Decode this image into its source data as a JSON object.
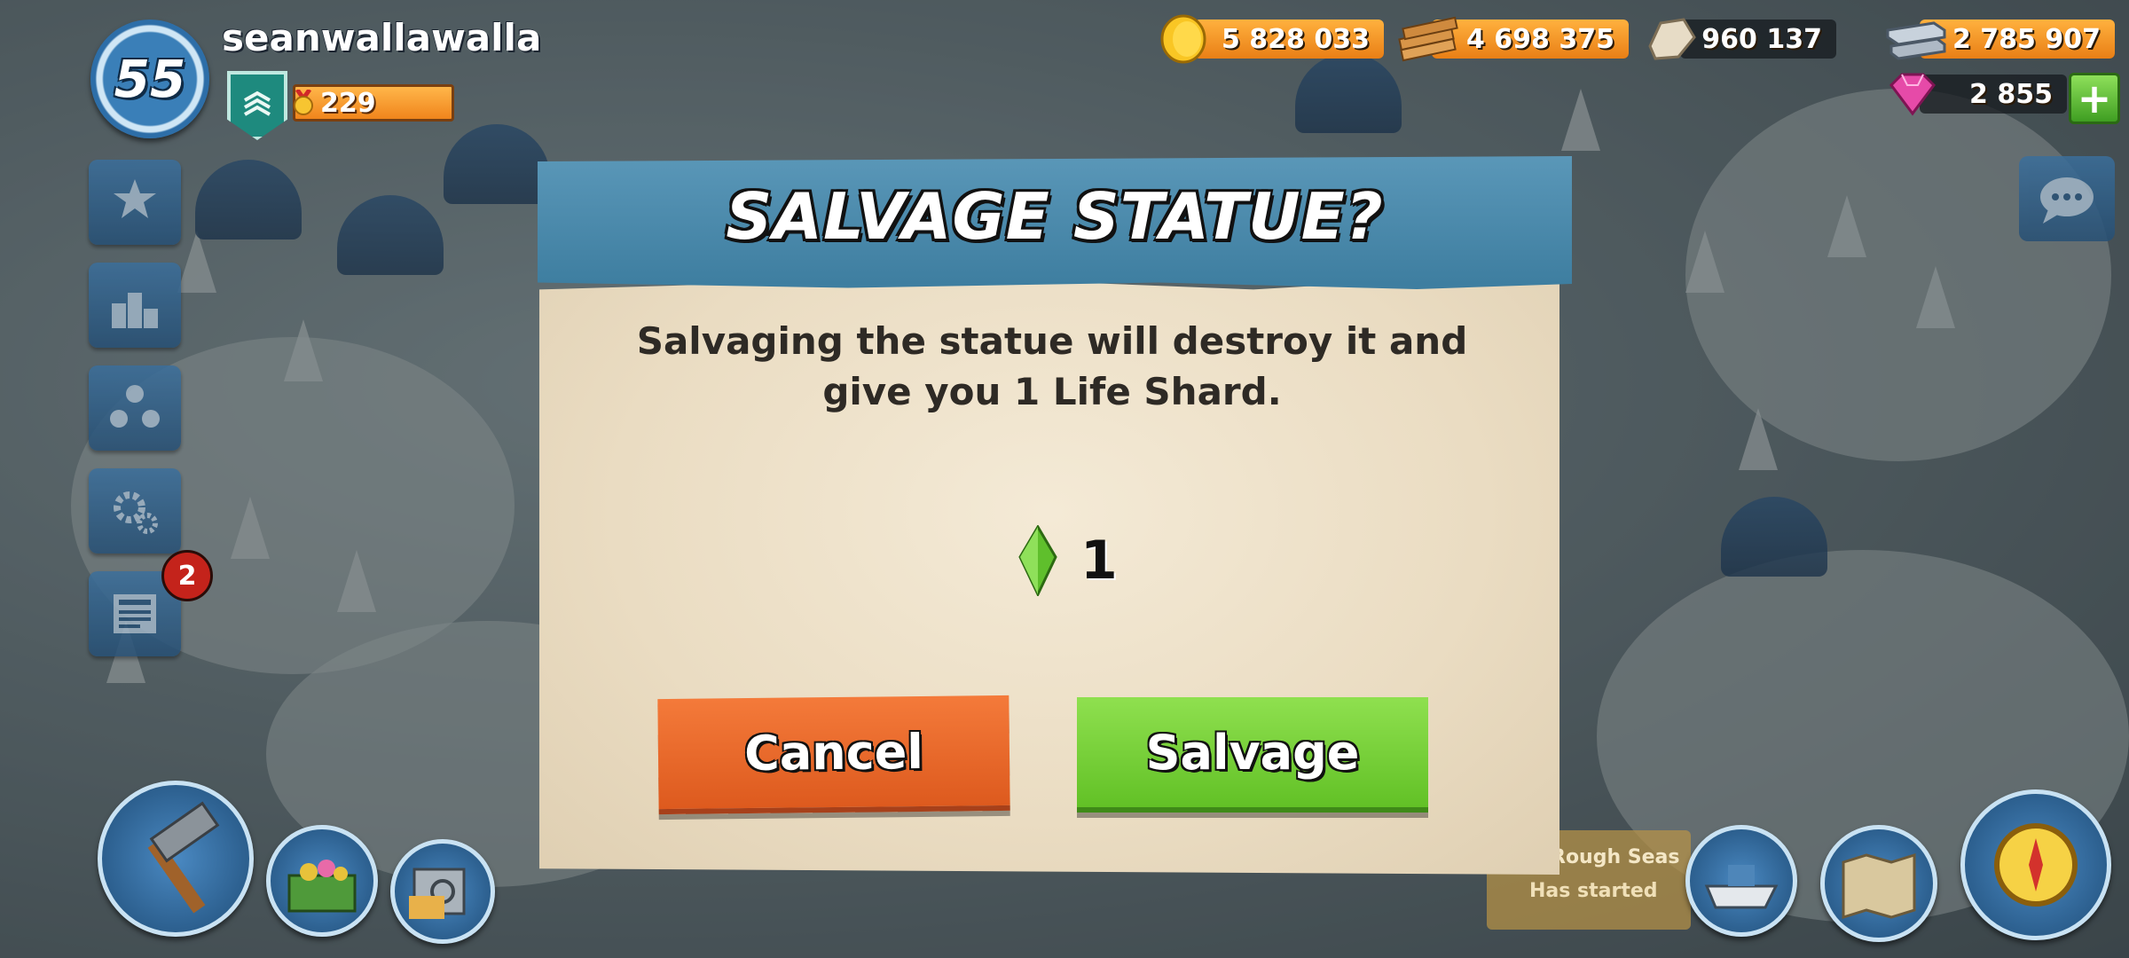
{
  "player": {
    "level": "55",
    "username": "seanwallawalla",
    "victory_points": "229"
  },
  "resources": {
    "gold": "5 828 033",
    "wood": "4 698 375",
    "stone": "960 137",
    "iron": "2 785 907",
    "diamonds": "2 855"
  },
  "side_menu": {
    "notification_count": "2"
  },
  "event": {
    "title": "Rough Seas",
    "status": "Has started"
  },
  "dialog": {
    "title": "SALVAGE STATUE?",
    "message_line1": "Salvaging the statue will destroy it and",
    "message_line2": "give you 1 Life Shard.",
    "reward_amount": "1",
    "cancel_label": "Cancel",
    "confirm_label": "Salvage"
  },
  "colors": {
    "cancel": "#e8652a",
    "confirm": "#7bd23a",
    "header": "#4b8aac"
  }
}
